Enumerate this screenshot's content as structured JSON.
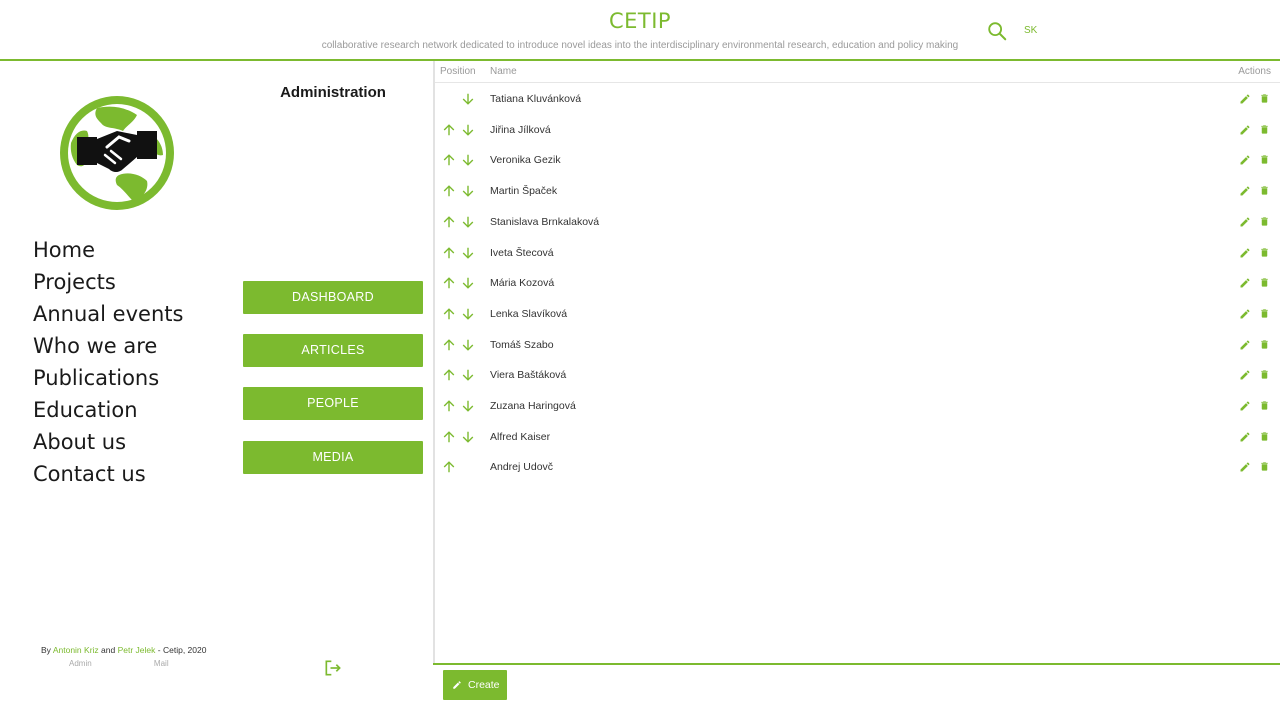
{
  "header": {
    "title": "CETIP",
    "subtitle": "collaborative research network dedicated to introduce novel ideas into the interdisciplinary environmental research, education and policy making",
    "language": "SK"
  },
  "nav": {
    "items": [
      "Home",
      "Projects",
      "Annual events",
      "Who we are",
      "Publications",
      "Education",
      "About us",
      "Contact us"
    ]
  },
  "admin": {
    "title": "Administration",
    "buttons": [
      "DASHBOARD",
      "ARTICLES",
      "PEOPLE",
      "MEDIA"
    ]
  },
  "footer": {
    "prefix": "By",
    "author1": "Antonin Kriz",
    "and": "and",
    "author2": "Petr Jelek",
    "suffix": "- Cetip, 2020",
    "links": [
      "Admin",
      "Mail"
    ]
  },
  "table": {
    "headers": {
      "position": "Position",
      "name": "Name",
      "actions": "Actions"
    },
    "rows": [
      {
        "name": "Tatiana Kluvánková",
        "up": false,
        "down": true
      },
      {
        "name": "Jiřina Jílková",
        "up": true,
        "down": true
      },
      {
        "name": "Veronika Gezik",
        "up": true,
        "down": true
      },
      {
        "name": "Martin Špaček",
        "up": true,
        "down": true
      },
      {
        "name": "Stanislava Brnkalaková",
        "up": true,
        "down": true
      },
      {
        "name": "Iveta Štecová",
        "up": true,
        "down": true
      },
      {
        "name": "Mária Kozová",
        "up": true,
        "down": true
      },
      {
        "name": "Lenka Slavíková",
        "up": true,
        "down": true
      },
      {
        "name": "Tomáš Szabo",
        "up": true,
        "down": true
      },
      {
        "name": "Viera Baštáková",
        "up": true,
        "down": true
      },
      {
        "name": "Zuzana Haringová",
        "up": true,
        "down": true
      },
      {
        "name": "Alfred Kaiser",
        "up": true,
        "down": true
      },
      {
        "name": "Andrej Udovč",
        "up": true,
        "down": false
      }
    ]
  },
  "create_label": "Create",
  "icons": {
    "search": "search-icon",
    "logo": "globe-handshake-logo",
    "up": "arrow-up-icon",
    "down": "arrow-down-icon",
    "edit": "pencil-icon",
    "delete": "trash-icon",
    "logout": "logout-icon"
  },
  "colors": {
    "accent": "#7cba2f",
    "text": "#1a1a1a",
    "muted": "#999999"
  }
}
